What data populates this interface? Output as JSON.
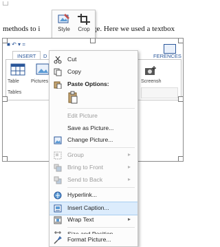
{
  "document": {
    "text_left": "methods to i",
    "text_right": "ge.  Here we used a textbox"
  },
  "mini_toolbar": {
    "style_label": "Style",
    "crop_label": "Crop"
  },
  "picture": {
    "tabs": [
      "INSERT",
      "D",
      "FERENCES"
    ],
    "ribbon": {
      "table_label": "Table",
      "pictures_label": "Pictures",
      "group_label": "Tables",
      "screenshot_label": "Screensh"
    }
  },
  "context_menu": {
    "items": [
      {
        "label": "Cut",
        "icon": "scissors-icon",
        "disabled": false
      },
      {
        "label": "Copy",
        "icon": "copy-icon",
        "disabled": false
      },
      {
        "label": "Paste Options:",
        "icon": "paste-icon",
        "disabled": false
      },
      {
        "label": "Edit Picture",
        "icon": "",
        "disabled": true
      },
      {
        "label": "Save as Picture...",
        "icon": "",
        "disabled": false
      },
      {
        "label": "Change Picture...",
        "icon": "change-picture-icon",
        "disabled": false
      },
      {
        "label": "Group",
        "icon": "group-icon",
        "disabled": true,
        "submenu": true
      },
      {
        "label": "Bring to Front",
        "icon": "bring-front-icon",
        "disabled": true,
        "submenu": true
      },
      {
        "label": "Send to Back",
        "icon": "send-back-icon",
        "disabled": true,
        "submenu": true
      },
      {
        "label": "Hyperlink...",
        "icon": "hyperlink-icon",
        "disabled": false
      },
      {
        "label": "Insert Caption...",
        "icon": "caption-icon",
        "disabled": false,
        "highlighted": true
      },
      {
        "label": "Wrap Text",
        "icon": "wrap-text-icon",
        "disabled": false,
        "submenu": true
      },
      {
        "label": "Size and Position...",
        "icon": "size-position-icon",
        "disabled": false
      },
      {
        "label": "Format Picture...",
        "icon": "format-picture-icon",
        "disabled": false
      }
    ]
  },
  "colors": {
    "accent": "#2b579a",
    "highlight_bg": "#dcecfc",
    "disabled_text": "#9b9b9b"
  }
}
